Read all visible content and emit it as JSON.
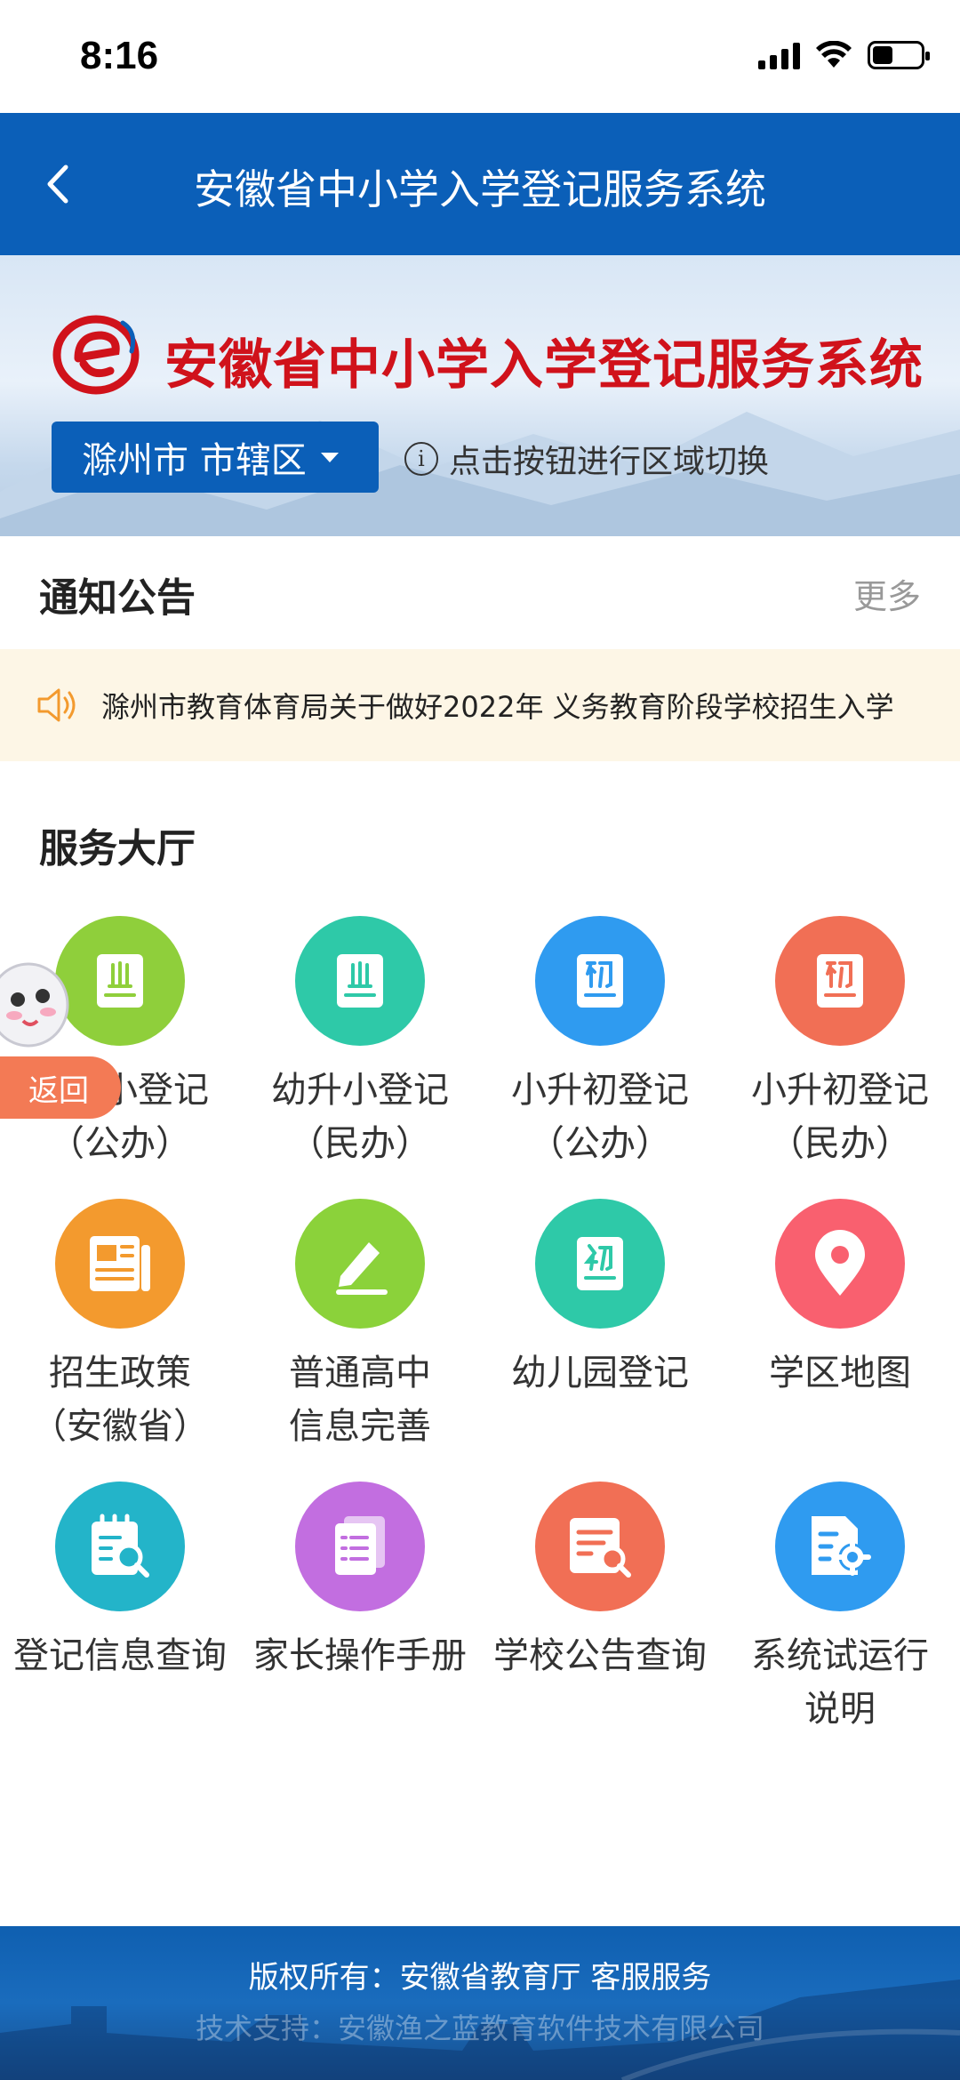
{
  "status_bar": {
    "time": "8:16"
  },
  "nav": {
    "title": "安徽省中小学入学登记服务系统"
  },
  "banner": {
    "title": "安徽省中小学入学登记服务系统",
    "region_button": "滁州市 市辖区",
    "region_hint": "点击按钮进行区域切换"
  },
  "notice": {
    "title": "通知公告",
    "more": "更多",
    "marquee": "滁州市教育体育局关于做好2022年 义务教育阶段学校招生入学"
  },
  "service_hall": {
    "title": "服务大厅",
    "items": [
      {
        "line1": "幼升小登记",
        "line2": "（公办）",
        "icon": "book-xiao-icon",
        "color": "#8fcf3b"
      },
      {
        "line1": "幼升小登记",
        "line2": "（民办）",
        "icon": "book-xiao-icon",
        "color": "#2ec9a8"
      },
      {
        "line1": "小升初登记",
        "line2": "（公办）",
        "icon": "book-chu-icon",
        "color": "#2f9bf0"
      },
      {
        "line1": "小升初登记",
        "line2": "（民办）",
        "icon": "book-chu-icon",
        "color": "#f16f55"
      },
      {
        "line1": "招生政策",
        "line2": "（安徽省）",
        "icon": "newspaper-icon",
        "color": "#f39a2e"
      },
      {
        "line1": "普通高中",
        "line2": "信息完善",
        "icon": "pencil-icon",
        "color": "#8bd23a"
      },
      {
        "line1": "幼儿园登记",
        "line2": "",
        "icon": "book-you-icon",
        "color": "#2ec9a8"
      },
      {
        "line1": "学区地图",
        "line2": "",
        "icon": "location-pin-icon",
        "color": "#f9606f"
      },
      {
        "line1": "登记信息查询",
        "line2": "",
        "icon": "notebook-search-icon",
        "color": "#23b4c9"
      },
      {
        "line1": "家长操作手册",
        "line2": "",
        "icon": "manual-list-icon",
        "color": "#c26ee0"
      },
      {
        "line1": "学校公告查询",
        "line2": "",
        "icon": "document-search-icon",
        "color": "#f16f55"
      },
      {
        "line1": "系统试运行",
        "line2": "说明",
        "icon": "document-gear-icon",
        "color": "#2f9bf0"
      }
    ]
  },
  "float_back": {
    "label": "返回"
  },
  "footer": {
    "copyright": "版权所有：安徽省教育厅 客服服务",
    "support": "技术支持：安徽渔之蓝教育软件技术有限公司"
  }
}
